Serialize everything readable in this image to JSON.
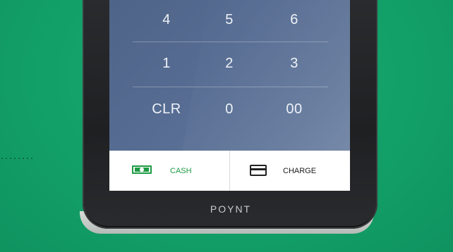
{
  "keypad": {
    "rows": [
      [
        "4",
        "5",
        "6"
      ],
      [
        "1",
        "2",
        "3"
      ],
      [
        "CLR",
        "0",
        "00"
      ]
    ]
  },
  "actions": {
    "cash_label": "CASH",
    "charge_label": "CHARGE"
  },
  "device": {
    "brand": "POYNT"
  },
  "colors": {
    "background": "#15a06d",
    "screen": "#566c92",
    "cash_accent": "#1e9a44"
  },
  "icons": [
    "cash-icon",
    "card-icon"
  ]
}
